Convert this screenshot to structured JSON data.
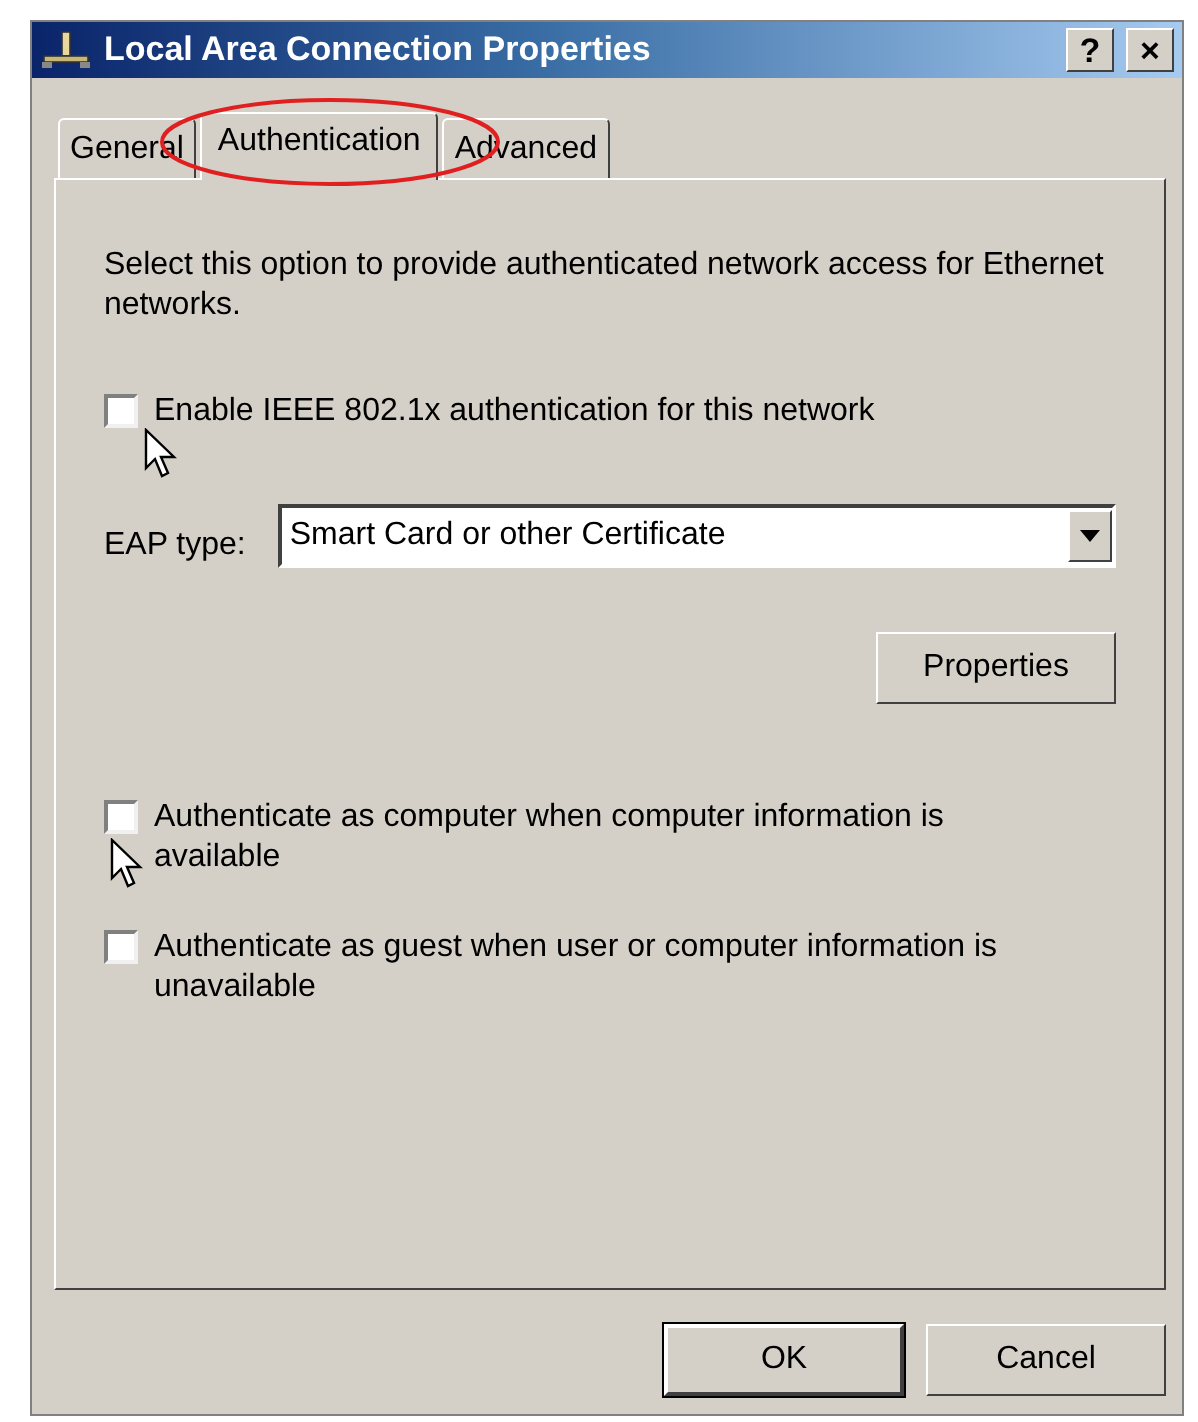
{
  "window": {
    "title": "Local Area Connection Properties",
    "title_buttons": [
      "?",
      "×"
    ]
  },
  "tabs": [
    {
      "label": "General",
      "selected": false,
      "circled": false
    },
    {
      "label": "Authentication",
      "selected": true,
      "circled": true
    },
    {
      "label": "Advanced",
      "selected": false,
      "circled": false
    }
  ],
  "description": "Select this option to provide authenticated network access for Ethernet networks.",
  "options": [
    {
      "label": "Enable IEEE 802.1x authentication for this network",
      "checked": false,
      "mouse_pointer": true
    }
  ],
  "eap": {
    "label": "EAP type:",
    "value": "Smart Card or other Certificate"
  },
  "properties_button": "Properties",
  "auth_options": [
    {
      "label": "Authenticate as computer when computer information is available",
      "checked": false,
      "mouse_pointer": true
    },
    {
      "label": "Authenticate as guest when user or computer information is unavailable",
      "checked": false
    }
  ],
  "buttons": [
    "OK",
    "Cancel"
  ]
}
